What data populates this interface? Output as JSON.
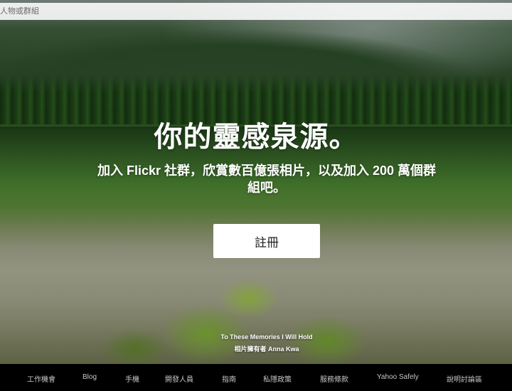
{
  "search": {
    "placeholder": "人物或群組"
  },
  "hero": {
    "title": "你的靈感泉源。",
    "subtitle": "加入 Flickr 社群，欣賞數百億張相片，以及加入 200 萬個群組吧。",
    "signup_label": "註冊"
  },
  "credit": {
    "photo_title": "To These Memories I Will Hold",
    "photo_owner": "相片擁有者 Anna Kwa"
  },
  "footer": {
    "links": [
      "工作機會",
      "Blog",
      "手機",
      "開發人員",
      "指南",
      "私隱政策",
      "服務條款",
      "Yahoo Safely",
      "說明討論區"
    ]
  }
}
